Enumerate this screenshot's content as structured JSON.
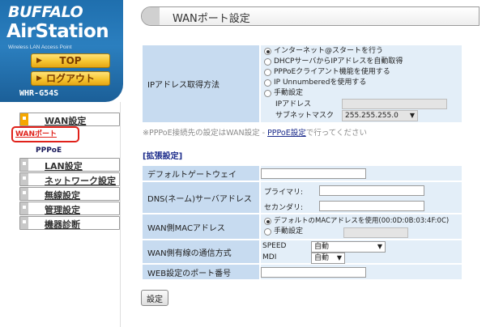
{
  "brand": {
    "buffalo": "BUFFALO",
    "airstation": "AirStation",
    "subtitle": "Wireless LAN Access Point",
    "model": "WHR-G54S"
  },
  "top_buttons": {
    "top_label": "TOP",
    "logout_label": "ログアウト"
  },
  "nav": {
    "wan": "WAN設定",
    "wan_sub": [
      "WANポート",
      "PPPoE"
    ],
    "lan": "LAN設定",
    "network": "ネットワーク設定",
    "wireless": "無線設定",
    "admin": "管理設定",
    "diag": "機器診断"
  },
  "header": {
    "title": "WANポート設定"
  },
  "ip_section": {
    "label": "IPアドレス取得方法",
    "options": [
      "インターネット@スタートを行う",
      "DHCPサーバからIPアドレスを自動取得",
      "PPPoEクライアント機能を使用する",
      "IP Unnumberedを使用する",
      "手動設定"
    ],
    "selected_index": 0,
    "ip_label": "IPアドレス",
    "ip_value": "",
    "mask_label": "サブネットマスク",
    "mask_value": "255.255.255.0"
  },
  "note": {
    "prefix": "※PPPoE接続先の設定はWAN設定 - ",
    "link": "PPPoE設定",
    "suffix": "で行ってください"
  },
  "extended": {
    "heading": "[拡張設定]",
    "gateway_label": "デフォルトゲートウェイ",
    "gateway_value": "",
    "dns_label": "DNS(ネーム)サーバアドレス",
    "dns_primary_label": "プライマリ:",
    "dns_primary_value": "",
    "dns_secondary_label": "セカンダリ:",
    "dns_secondary_value": "",
    "mac_label": "WAN側MACアドレス",
    "mac_default": "デフォルトのMACアドレスを使用(00:0D:0B:03:4F:0C)",
    "mac_manual": "手動設定",
    "mac_manual_value": "",
    "wired_label": "WAN側有線の通信方式",
    "speed_label": "SPEED",
    "speed_value": "自動",
    "mdi_label": "MDI",
    "mdi_value": "自動",
    "web_port_label": "WEB設定のポート番号",
    "web_port_value": ""
  },
  "submit_label": "設定",
  "colors": {
    "brand_blue": "#1f6fae",
    "label_cell": "#c7dbf0",
    "value_cell": "#e3eef8",
    "highlight_red": "#e0211a",
    "gold": "#f6c531"
  }
}
